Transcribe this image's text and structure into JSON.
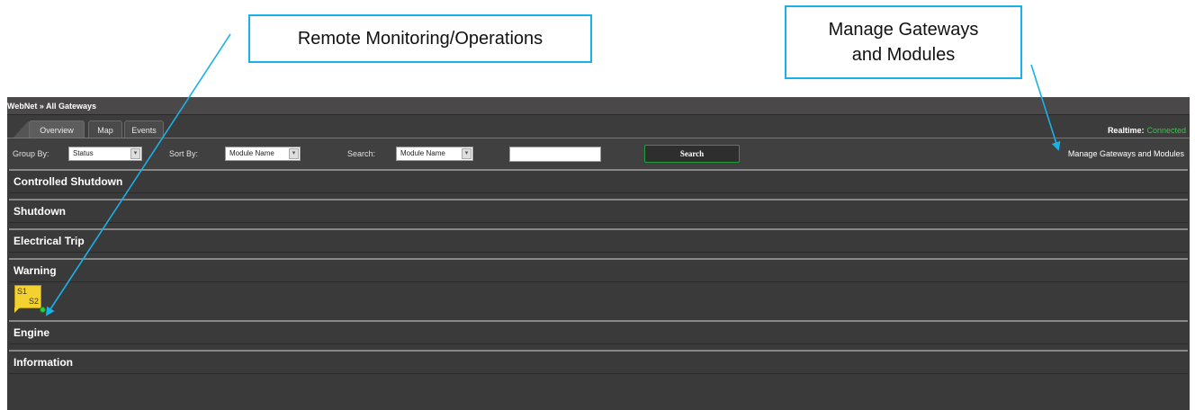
{
  "callouts": {
    "remote_monitoring": "Remote Monitoring/Operations",
    "manage_line1": "Manage Gateways",
    "manage_line2": "and Modules"
  },
  "app": {
    "breadcrumb": "WebNet » All Gateways",
    "tabs": [
      {
        "label": "Overview",
        "active": true
      },
      {
        "label": "Map",
        "active": false
      },
      {
        "label": "Events",
        "active": false
      }
    ],
    "realtime_label": "Realtime:",
    "realtime_status": "Connected",
    "realtime_status_color": "#2ecc40"
  },
  "toolbar": {
    "group_by_label": "Group By:",
    "group_by_value": "Status",
    "sort_by_label": "Sort By:",
    "sort_by_value": "Module Name",
    "search_label": "Search:",
    "search_field_value": "Module Name",
    "search_input_value": "",
    "search_button": "Search",
    "manage_link": "Manage Gateways and Modules"
  },
  "groups": [
    {
      "label": "Controlled Shutdown"
    },
    {
      "label": "Shutdown"
    },
    {
      "label": "Electrical Trip"
    },
    {
      "label": "Warning"
    },
    {
      "label": "Engine"
    },
    {
      "label": "Information"
    }
  ],
  "module": {
    "s1": "S1",
    "s2": "S2",
    "tile_color": "#f2d130",
    "status_dot_color": "#2ecc40"
  },
  "accent_color": "#1ab0e8"
}
